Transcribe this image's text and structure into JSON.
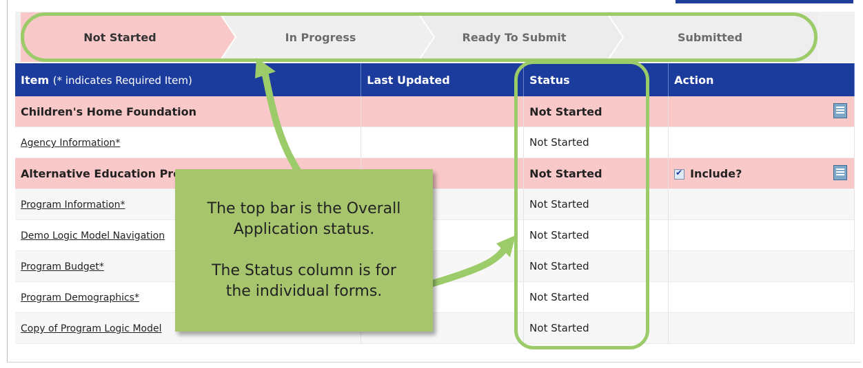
{
  "progress_steps": [
    {
      "label": "Not Started",
      "active": true
    },
    {
      "label": "In Progress",
      "active": false
    },
    {
      "label": "Ready To Submit",
      "active": false
    },
    {
      "label": "Submitted",
      "active": false
    }
  ],
  "table": {
    "headers": {
      "item": "Item",
      "item_note": "(* indicates Required Item)",
      "last_updated": "Last Updated",
      "status": "Status",
      "action": "Action"
    },
    "rows": [
      {
        "item": "Children's Home Foundation",
        "last_updated": "",
        "status": "Not Started",
        "action": ""
      },
      {
        "item": "Agency Information*",
        "last_updated": "",
        "status": "Not Started",
        "action": ""
      },
      {
        "item": "Alternative Education Prog",
        "last_updated": "",
        "status": "Not Started",
        "action": "Include?"
      },
      {
        "item": "Program Information*",
        "last_updated": "",
        "status": "Not Started",
        "action": ""
      },
      {
        "item": "Demo Logic Model Navigation",
        "last_updated": "",
        "status": "Not Started",
        "action": ""
      },
      {
        "item": "Program Budget*",
        "last_updated": "",
        "status": "Not Started",
        "action": ""
      },
      {
        "item": "Program Demographics*",
        "last_updated": "",
        "status": "Not Started",
        "action": ""
      },
      {
        "item": "Copy of Program Logic Model",
        "last_updated": "",
        "status": "Not Started",
        "action": ""
      }
    ]
  },
  "callout": {
    "line1": "The top bar is the Overall",
    "line2": "Application status.",
    "line3": "The Status column is for",
    "line4": "the individual forms."
  },
  "colors": {
    "header": "#1b3c9c",
    "pink": "#f9c8c9",
    "highlight": "#9ccb6a",
    "callout": "#a7c56d"
  }
}
